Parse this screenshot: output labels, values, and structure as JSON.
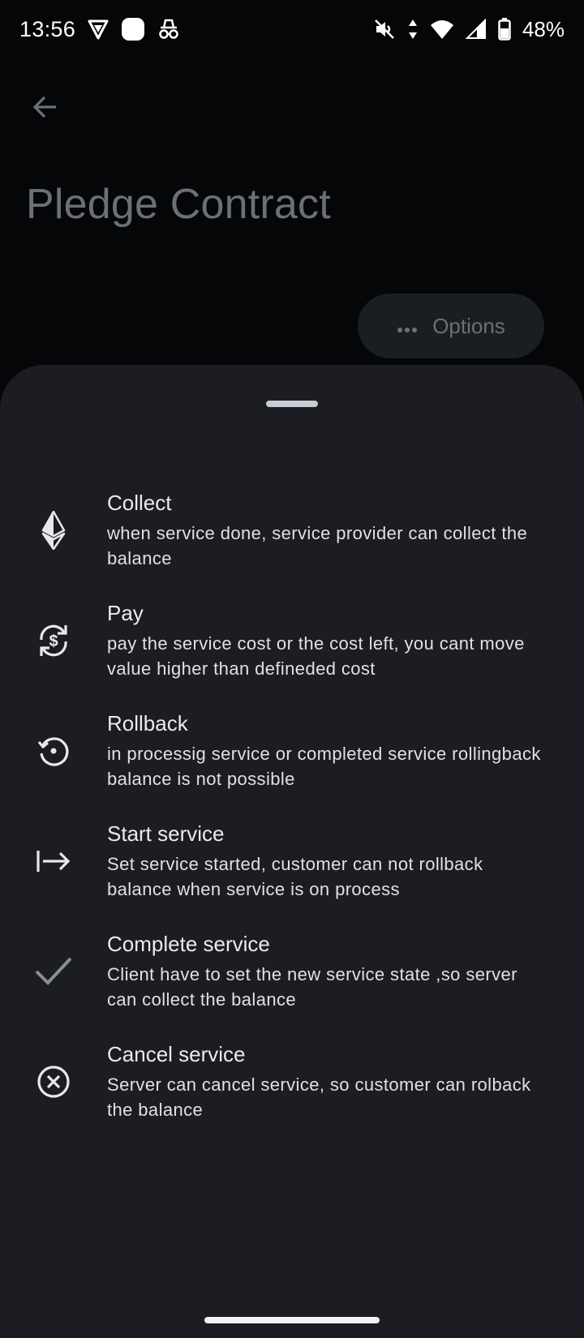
{
  "status_bar": {
    "time": "13:56",
    "battery": "48%",
    "icons": [
      "vpn-shield-icon",
      "app-notification-icon",
      "incognito-icon",
      "mute-icon",
      "data-arrows-icon",
      "wifi-icon",
      "cell-signal-icon",
      "battery-icon"
    ]
  },
  "header": {
    "back_icon": "arrow-left-icon",
    "title": "Pledge Contract",
    "options_label": "Options",
    "options_icon": "more-horiz-icon"
  },
  "sheet": {
    "items": [
      {
        "title": "Collect",
        "desc": "when service done, service provider can collect the balance",
        "icon": "ethereum-icon"
      },
      {
        "title": "Pay",
        "desc": "pay the service cost or the cost left, you cant move value higher than defineded cost",
        "icon": "currency-exchange-icon"
      },
      {
        "title": "Rollback",
        "desc": "in processig service or completed service rollingback balance is not possible",
        "icon": "rollback-icon"
      },
      {
        "title": "Start service",
        "desc": "Set service started, customer can not rollback balance when service is on process",
        "icon": "arrow-right-bar-icon"
      },
      {
        "title": "Complete service",
        "desc": "Client have to set the new service state ,so server can collect the balance",
        "icon": "check-icon"
      },
      {
        "title": "Cancel service",
        "desc": "Server can cancel service, so customer can rolback the balance",
        "icon": "cancel-circle-icon"
      }
    ]
  },
  "colors": {
    "background": "#050607",
    "sheet": "#1b1d22",
    "dim_text": "#6c6f75",
    "text": "#e9ebef"
  }
}
